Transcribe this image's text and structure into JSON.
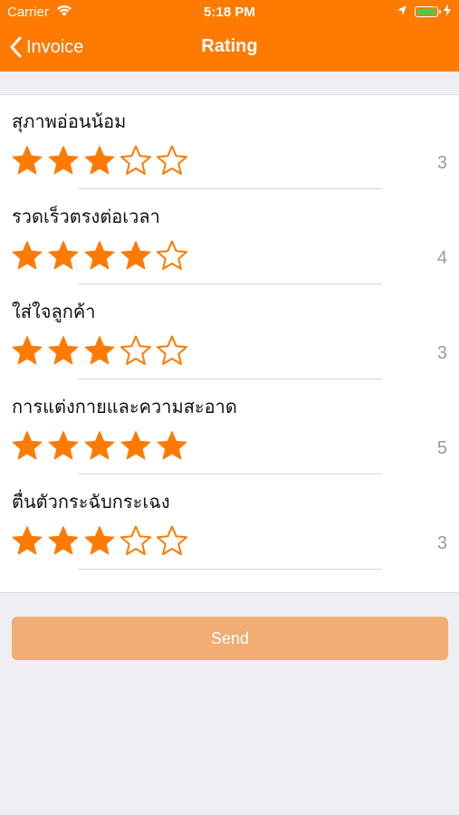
{
  "status_bar": {
    "carrier": "Carrier",
    "time": "5:18 PM"
  },
  "nav": {
    "back_label": "Invoice",
    "title": "Rating"
  },
  "colors": {
    "accent": "#ff7a00",
    "send_button": "#f2ad74",
    "star": "#ff7a00"
  },
  "ratings": [
    {
      "label": "สุภาพอ่อนน้อม",
      "score": "3",
      "value": 3,
      "max": 5
    },
    {
      "label": "รวดเร็วตรงต่อเวลา",
      "score": "4",
      "value": 4,
      "max": 5
    },
    {
      "label": "ใส่ใจลูกค้า",
      "score": "3",
      "value": 3,
      "max": 5
    },
    {
      "label": "การแต่งกายและความสะอาด",
      "score": "5",
      "value": 5,
      "max": 5
    },
    {
      "label": "ตื่นตัวกระฉับกระเฉง",
      "score": "3",
      "value": 3,
      "max": 5
    }
  ],
  "send_label": "Send"
}
